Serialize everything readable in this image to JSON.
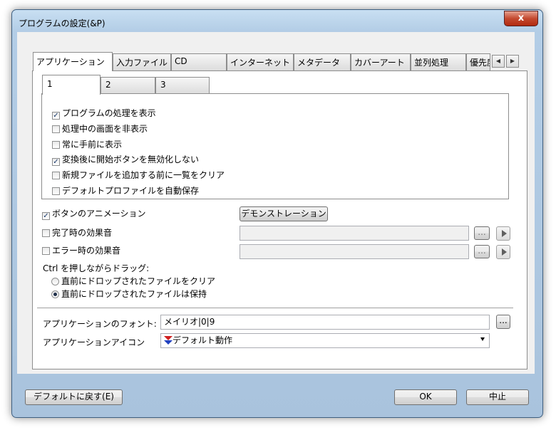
{
  "window": {
    "title": "プログラムの設定(&P)",
    "close_label": "x"
  },
  "tabs": [
    "アプリケーション",
    "入力ファイル",
    "CD",
    "インターネット",
    "メタデータ",
    "カバーアート",
    "並列処理",
    "優先度"
  ],
  "tab_scroll": {
    "left": "◀",
    "right": "▶"
  },
  "subtabs": [
    "1",
    "2",
    "3"
  ],
  "sub_options": [
    {
      "label": "プログラムの処理を表示",
      "checked": true
    },
    {
      "label": "処理中の画面を非表示",
      "checked": false
    },
    {
      "label": "常に手前に表示",
      "checked": false
    },
    {
      "label": "変換後に開始ボタンを無効化しない",
      "checked": true
    },
    {
      "label": "新規ファイルを追加する前に一覧をクリア",
      "checked": false
    },
    {
      "label": "デフォルトプロファイルを自動保存",
      "checked": false
    }
  ],
  "animation": {
    "label": "ボタンのアニメーション",
    "checked": true,
    "demo_label": "デモンストレーション"
  },
  "sounds": {
    "complete_label": "完了時の効果音",
    "error_label": "エラー時の効果音",
    "browse_label": "..."
  },
  "drag": {
    "label": "Ctrl を押しながらドラッグ:",
    "options": [
      {
        "label": "直前にドロップされたファイルをクリア",
        "selected": false
      },
      {
        "label": "直前にドロップされたファイルは保持",
        "selected": true
      }
    ]
  },
  "font": {
    "label": "アプリケーションのフォント:",
    "value": "メイリオ|0|9",
    "browse_label": "..."
  },
  "icon": {
    "label": "アプリケーションアイコン",
    "value": "デフォルト動作"
  },
  "footer": {
    "reset_label": "デフォルトに戻す(E)",
    "ok_label": "OK",
    "cancel_label": "中止"
  },
  "colors": {
    "titlebar": "#b3cde6",
    "close": "#c44a30",
    "client": "#f0f0f0",
    "check": "#1a3a6b"
  }
}
